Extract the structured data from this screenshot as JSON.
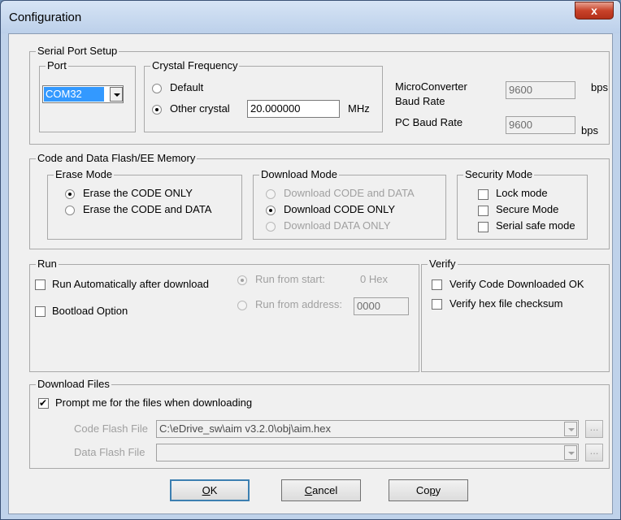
{
  "window": {
    "title": "Configuration",
    "close_glyph": "x"
  },
  "serial": {
    "legend": "Serial Port Setup",
    "port": {
      "legend": "Port",
      "value": "COM32"
    },
    "crystal": {
      "legend": "Crystal Frequency",
      "default_label": "Default",
      "other_label": "Other crystal",
      "value": "20.000000",
      "unit": "MHz",
      "selected": "other"
    },
    "micro_baud": {
      "label_line1": "MicroConverter",
      "label_line2": "Baud Rate",
      "value": "9600",
      "unit": "bps"
    },
    "pc_baud": {
      "label": "PC Baud Rate",
      "value": "9600",
      "unit": "bps"
    }
  },
  "flash": {
    "legend": "Code and Data Flash/EE Memory",
    "erase": {
      "legend": "Erase Mode",
      "options": [
        "Erase the CODE ONLY",
        "Erase the CODE and DATA"
      ],
      "selected": 0
    },
    "download": {
      "legend": "Download Mode",
      "options": [
        "Download CODE and DATA",
        "Download CODE ONLY",
        "Download DATA ONLY"
      ],
      "selected": 1
    },
    "security": {
      "legend": "Security Mode",
      "options": [
        "Lock mode",
        "Secure Mode",
        "Serial safe mode"
      ]
    }
  },
  "run": {
    "legend": "Run",
    "auto_label": "Run Automatically after download",
    "bootload_label": "Bootload Option",
    "from_start_label": "Run from start:",
    "from_start_value": "0 Hex",
    "from_address_label": "Run from address:",
    "from_address_value": "0000"
  },
  "verify": {
    "legend": "Verify",
    "options": [
      "Verify Code Downloaded OK",
      "Verify hex file checksum"
    ]
  },
  "files": {
    "legend": "Download Files",
    "prompt_label": "Prompt me for the files when downloading",
    "prompt_checked": true,
    "code_label": "Code Flash File",
    "code_value": "C:\\eDrive_sw\\aim v3.2.0\\obj\\aim.hex",
    "data_label": "Data Flash File",
    "data_value": "",
    "browse_label": "..."
  },
  "buttons": {
    "ok": {
      "mnemonic": "O",
      "rest": "K"
    },
    "cancel": {
      "mnemonic": "C",
      "rest": "ancel"
    },
    "copy": {
      "prefix": "Co",
      "mnemonic": "p",
      "rest": "y"
    }
  }
}
